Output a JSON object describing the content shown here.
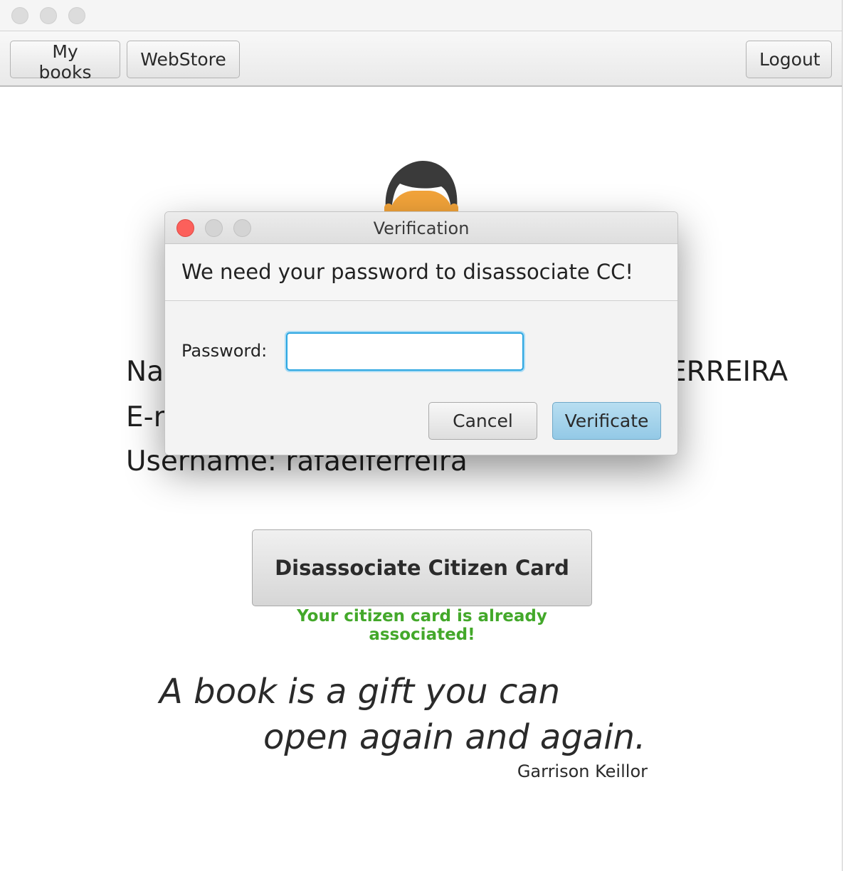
{
  "window": {
    "toolbar": {
      "my_books": "My books",
      "webstore": "WebStore",
      "logout": "Logout"
    }
  },
  "profile": {
    "name_prefix": "Na",
    "name_suffix": "ERREIRA",
    "email_prefix": "E-r",
    "username_line": "Username: rafaelferreira"
  },
  "citizen_card": {
    "button_label": "Disassociate Citizen Card",
    "status_text": "Your citizen card is already associated!",
    "status_color": "#43a82a"
  },
  "quote": {
    "line1": "A book is a gift you can",
    "line2": "open again and again.",
    "author": "Garrison Keillor"
  },
  "dialog": {
    "title": "Verification",
    "message": "We need your password to disassociate CC!",
    "password_label": "Password:",
    "password_value": "",
    "cancel_label": "Cancel",
    "verify_label": "Verificate",
    "accent_color": "#2ba6e1"
  }
}
